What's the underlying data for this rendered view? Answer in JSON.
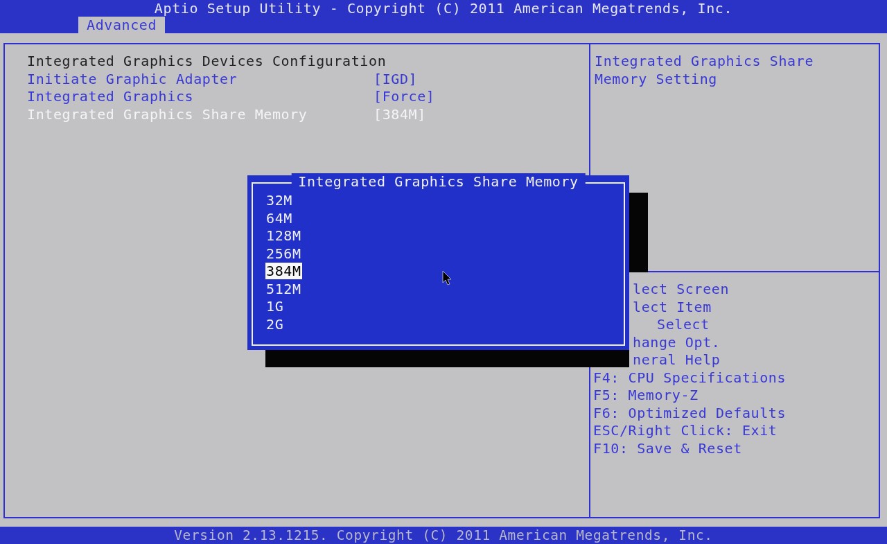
{
  "window": {
    "title": "Aptio Setup Utility - Copyright (C) 2011 American Megatrends, Inc."
  },
  "tabs": [
    {
      "label": "Advanced",
      "selected": true
    }
  ],
  "settings": {
    "heading": "Integrated Graphics Devices Configuration",
    "items": [
      {
        "label": "Initiate Graphic Adapter",
        "value": "[IGD]",
        "selected": false
      },
      {
        "label": "Integrated Graphics",
        "value": "[Force]",
        "selected": false
      },
      {
        "label": "Integrated Graphics Share Memory",
        "value": "[384M]",
        "selected": true
      }
    ]
  },
  "help": {
    "description": "Integrated Graphics Share Memory Setting",
    "keys": [
      {
        "text": "lect Screen",
        "kind": "clipped"
      },
      {
        "text": "lect Item",
        "kind": "clipped"
      },
      {
        "text": "Select",
        "kind": "clipped-more"
      },
      {
        "text": "hange Opt.",
        "kind": "clipped"
      },
      {
        "text": "neral Help",
        "kind": "clipped"
      },
      {
        "text": "F4: CPU Specifications",
        "kind": "full"
      },
      {
        "text": "F5: Memory-Z",
        "kind": "full"
      },
      {
        "text": "F6: Optimized Defaults",
        "kind": "full"
      },
      {
        "text": "ESC/Right Click: Exit",
        "kind": "full"
      },
      {
        "text": "F10: Save & Reset",
        "kind": "full"
      }
    ]
  },
  "popup": {
    "title": "Integrated Graphics Share Memory",
    "options": [
      {
        "label": "32M",
        "selected": false
      },
      {
        "label": "64M",
        "selected": false
      },
      {
        "label": "128M",
        "selected": false
      },
      {
        "label": "256M",
        "selected": false
      },
      {
        "label": "384M",
        "selected": true
      },
      {
        "label": "512M",
        "selected": false
      },
      {
        "label": "1G",
        "selected": false
      },
      {
        "label": "2G",
        "selected": false
      }
    ]
  },
  "status_bar": {
    "text": "Version 2.13.1215. Copyright (C) 2011 American Megatrends, Inc."
  }
}
